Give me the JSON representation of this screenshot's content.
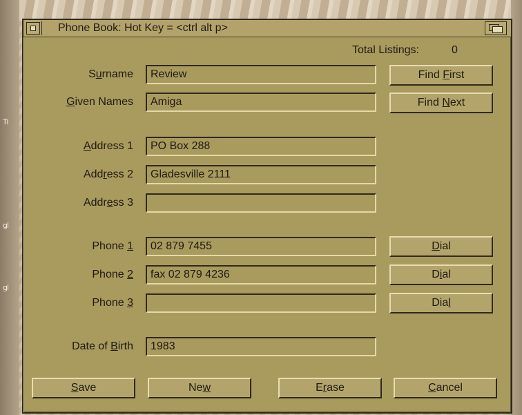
{
  "window": {
    "title": "Phone Book: Hot Key = <ctrl alt p>",
    "total_listings_label": "Total Listings:",
    "total_listings_value": "0"
  },
  "fields": {
    "surname": {
      "label": "Surname",
      "value": "Review"
    },
    "given_names": {
      "label": "Given Names",
      "value": "Amiga"
    },
    "address1": {
      "label": "Address 1",
      "value": "PO Box 288"
    },
    "address2": {
      "label": "Address 2",
      "value": "Gladesville 2111"
    },
    "address3": {
      "label": "Address 3",
      "value": ""
    },
    "phone1": {
      "label": "Phone 1",
      "value": "02 879 7455"
    },
    "phone2": {
      "label": "Phone 2",
      "value": "fax 02 879 4236"
    },
    "phone3": {
      "label": "Phone 3",
      "value": ""
    },
    "dob": {
      "label": "Date of Birth",
      "value": "1983"
    }
  },
  "buttons": {
    "find_first": "Find First",
    "find_next": "Find Next",
    "dial1": "Dial",
    "dial2": "Dial",
    "dial3": "Dial",
    "save": "Save",
    "new": "New",
    "erase": "Erase",
    "cancel": "Cancel"
  },
  "colors": {
    "window_bg": "#a99a5e",
    "text": "#1e1b12",
    "shine": "#e4d9a8",
    "shadow": "#2f2a19"
  },
  "icons": {
    "close": "close-gadget-icon",
    "depth": "depth-gadget-icon"
  }
}
